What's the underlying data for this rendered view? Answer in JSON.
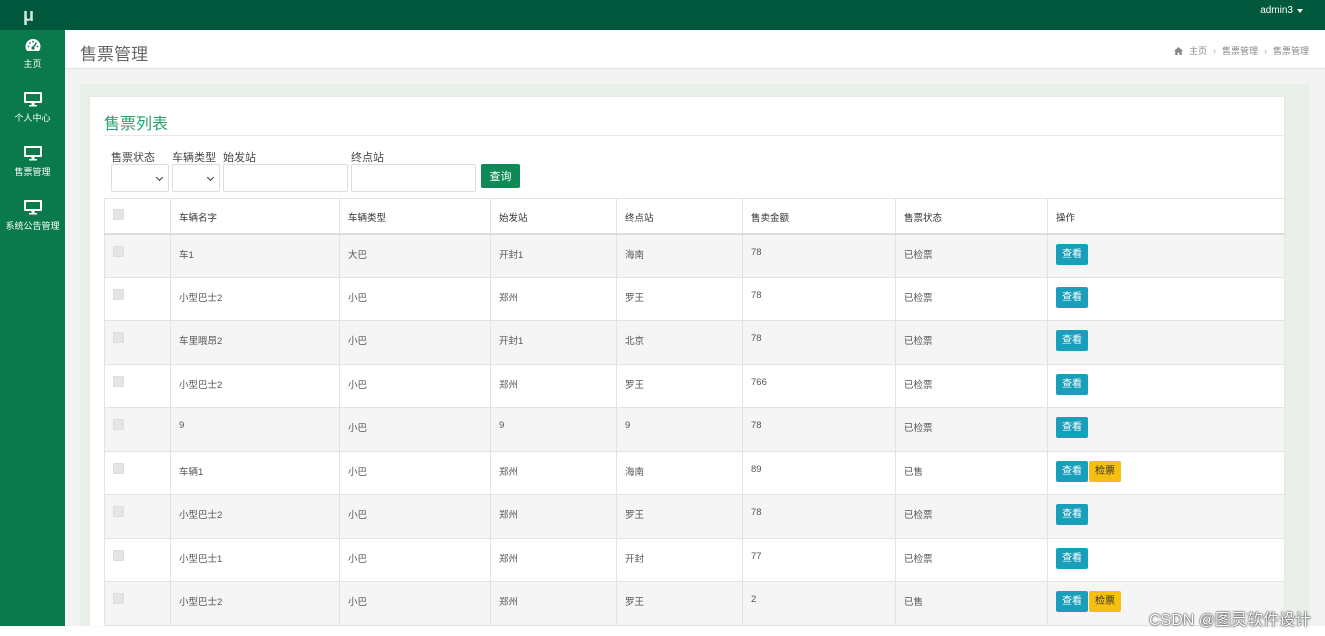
{
  "app": {
    "logo_text": "μ",
    "user": "admin3",
    "brand_color": "#01583d",
    "sidebar_color": "#0a7a4d",
    "accent_color": "#2aa36a"
  },
  "sidebar": {
    "items": [
      {
        "label": "主页",
        "icon": "dashboard-icon"
      },
      {
        "label": "个人中心",
        "icon": "monitor-icon"
      },
      {
        "label": "售票管理",
        "icon": "monitor-icon"
      },
      {
        "label": "系统公告管理",
        "icon": "monitor-icon"
      }
    ]
  },
  "header": {
    "title": "售票管理",
    "breadcrumb": [
      "主页",
      "售票管理",
      "售票管理"
    ]
  },
  "card": {
    "title": "售票列表"
  },
  "filters": {
    "status_label": "售票状态",
    "type_label": "车辆类型",
    "start_label": "始发站",
    "end_label": "终点站",
    "status_value": "",
    "type_value": "",
    "start_value": "",
    "end_value": "",
    "search_label": "查询"
  },
  "table": {
    "columns": [
      "车辆名字",
      "车辆类型",
      "始发站",
      "终点站",
      "售卖金额",
      "售票状态",
      "操作"
    ],
    "view_label": "查看",
    "check_label": "检票",
    "rows": [
      {
        "name": "车1",
        "type": "大巴",
        "start": "开封1",
        "end": "海南",
        "amount": "78",
        "status": "已检票",
        "can_check": false
      },
      {
        "name": "小型巴士2",
        "type": "小巴",
        "start": "郑州",
        "end": "罗王",
        "amount": "78",
        "status": "已检票",
        "can_check": false
      },
      {
        "name": "车里哦昂2",
        "type": "小巴",
        "start": "开封1",
        "end": "北京",
        "amount": "78",
        "status": "已检票",
        "can_check": false
      },
      {
        "name": "小型巴士2",
        "type": "小巴",
        "start": "郑州",
        "end": "罗王",
        "amount": "766",
        "status": "已检票",
        "can_check": false
      },
      {
        "name": "9",
        "type": "小巴",
        "start": "9",
        "end": "9",
        "amount": "78",
        "status": "已检票",
        "can_check": false
      },
      {
        "name": "车辆1",
        "type": "小巴",
        "start": "郑州",
        "end": "海南",
        "amount": "89",
        "status": "已售",
        "can_check": true
      },
      {
        "name": "小型巴士2",
        "type": "小巴",
        "start": "郑州",
        "end": "罗王",
        "amount": "78",
        "status": "已检票",
        "can_check": false
      },
      {
        "name": "小型巴士1",
        "type": "小巴",
        "start": "郑州",
        "end": "开封",
        "amount": "77",
        "status": "已检票",
        "can_check": false
      },
      {
        "name": "小型巴士2",
        "type": "小巴",
        "start": "郑州",
        "end": "罗王",
        "amount": "2",
        "status": "已售",
        "can_check": true
      }
    ]
  },
  "watermark": "CSDN @图灵软件设计"
}
